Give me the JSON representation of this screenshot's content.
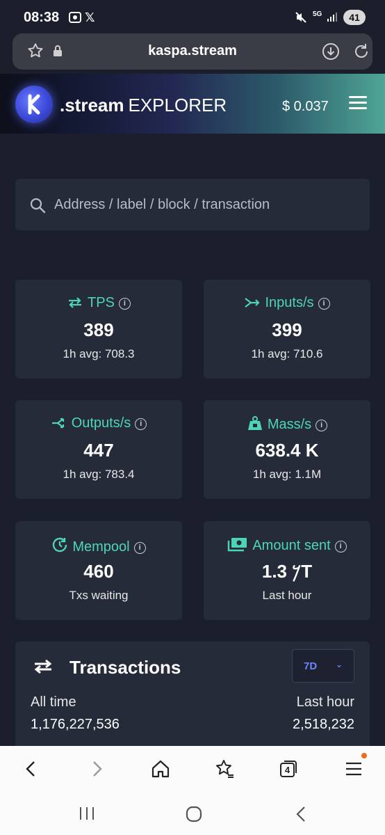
{
  "status_bar": {
    "time": "08:38",
    "network": "5G",
    "battery": "41"
  },
  "browser": {
    "url": "kaspa.stream"
  },
  "header": {
    "brand_bold": ".stream",
    "brand_light": "EXPLORER",
    "price": "$ 0.037"
  },
  "search": {
    "placeholder": "Address / label / block / transaction"
  },
  "stats": [
    {
      "label": "TPS",
      "value": "389",
      "sub": "1h avg: 708.3",
      "icon": "swap-arrows-icon"
    },
    {
      "label": "Inputs/s",
      "value": "399",
      "sub": "1h avg: 710.6",
      "icon": "merge-arrow-icon"
    },
    {
      "label": "Outputs/s",
      "value": "447",
      "sub": "1h avg: 783.4",
      "icon": "split-arrow-icon"
    },
    {
      "label": "Mass/s",
      "value": "638.4 K",
      "sub": "1h avg: 1.1M",
      "icon": "weight-icon"
    },
    {
      "label": "Mempool",
      "value": "460",
      "sub": "Txs waiting",
      "icon": "clock-refresh-icon"
    },
    {
      "label": "Amount sent",
      "value": "𐤊 1.3T",
      "sub": "Last hour",
      "icon": "money-icon"
    }
  ],
  "transactions": {
    "title": "Transactions",
    "range": "7D",
    "all_time_label": "All time",
    "all_time_value": "1,176,227,536",
    "last_hour_label": "Last hour",
    "last_hour_value": "2,518,232"
  },
  "browser_nav": {
    "tabs_count": "4"
  },
  "colors": {
    "accent": "#4dd6b5",
    "card": "#262b39",
    "background": "#1b1f2b",
    "range_text": "#6d86ff"
  }
}
